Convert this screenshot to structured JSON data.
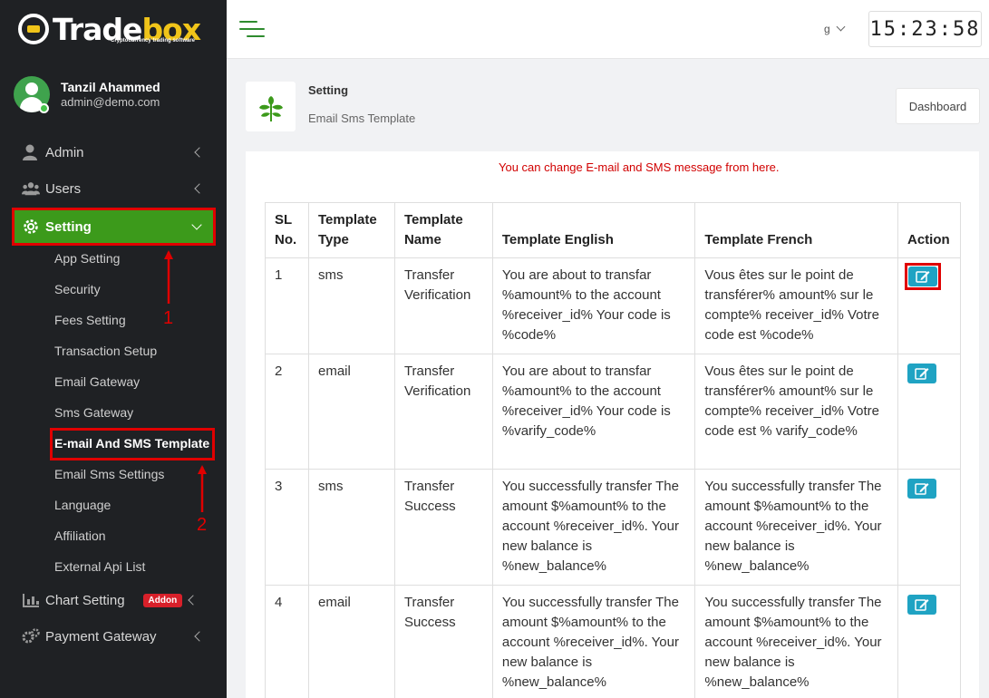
{
  "app": {
    "logo_text_a": "Trade",
    "logo_text_b": "box",
    "logo_sub": "Cryptocurrency trading software"
  },
  "user": {
    "name": "Tanzil Ahammed",
    "email": "admin@demo.com"
  },
  "sidebar": {
    "items": [
      {
        "label": "Admin",
        "icon": "admin-user-icon"
      },
      {
        "label": "Users",
        "icon": "users-group-icon"
      },
      {
        "label": "Setting",
        "icon": "gear-icon"
      }
    ],
    "sub_items": [
      "App Setting",
      "Security",
      "Fees Setting",
      "Transaction Setup",
      "Email Gateway",
      "Sms Gateway",
      "E-mail And SMS Template",
      "Email Sms Settings",
      "Language",
      "Affiliation",
      "External Api List"
    ],
    "bottom_items": [
      {
        "label": "Chart Setting",
        "icon": "bar-chart-icon",
        "badge": "Addon"
      },
      {
        "label": "Payment Gateway",
        "icon": "gears-icon"
      }
    ]
  },
  "annotations": {
    "num1": "1",
    "num2": "2",
    "note": "You can change E-mail and SMS message from here."
  },
  "topbar": {
    "lang": "g",
    "clock": "15:23:58"
  },
  "page": {
    "title": "Setting",
    "subtitle": "Email Sms Template",
    "dashboard_button": "Dashboard"
  },
  "table": {
    "headers": [
      "SL No.",
      "Template Type",
      "Template Name",
      "Template English",
      "Template French",
      "Action"
    ],
    "rows": [
      {
        "sl": "1",
        "type": "sms",
        "name": "Transfer Verification",
        "english": "You are about to transfar %amount% to the account %receiver_id% Your code is %code%",
        "french": "Vous êtes sur le point de transférer% amount% sur le compte% receiver_id% Votre code est %code%"
      },
      {
        "sl": "2",
        "type": "email",
        "name": "Transfer Verification",
        "english": "You are about to transfar %amount% to the account %receiver_id% Your code is %varify_code%",
        "french": "Vous êtes sur le point de transférer% amount% sur le compte% receiver_id% Votre code est % varify_code%"
      },
      {
        "sl": "3",
        "type": "sms",
        "name": "Transfer Success",
        "english": "You successfully transfer The amount $%amount% to the account %receiver_id%. Your new balance is %new_balance%",
        "french": "You successfully transfer The amount $%amount% to the account %receiver_id%. Your new balance is %new_balance%"
      },
      {
        "sl": "4",
        "type": "email",
        "name": "Transfer Success",
        "english": "You successfully transfer The amount $%amount% to the account %receiver_id%. Your new balance is %new_balance%",
        "french": "You successfully transfer The amount $%amount% to the account %receiver_id%. Your new balance is %new_balance%"
      }
    ]
  },
  "colors": {
    "sidebar_bg": "#1f2124",
    "active_green": "#3c9a1b",
    "annotation_red": "#e00000",
    "edit_button": "#1fa3c3"
  }
}
